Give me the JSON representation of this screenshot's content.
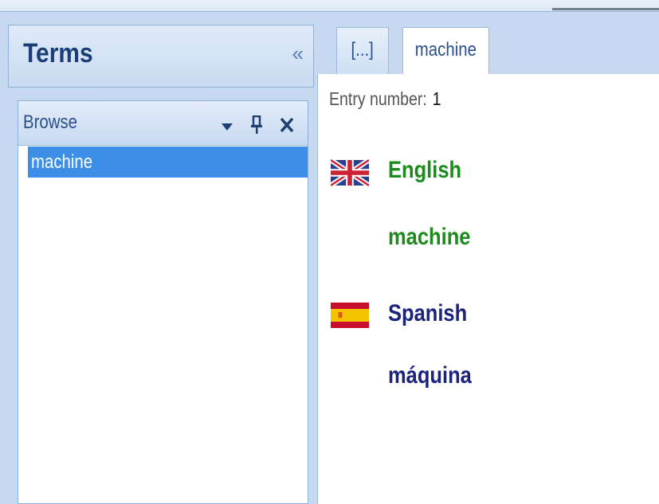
{
  "colors": {
    "english_green": "#1c8a1c",
    "spanish_navy": "#1b237a",
    "selection_blue": "#3d8ee6",
    "panel_blue": "#c6d9f1"
  },
  "terms_panel": {
    "title": "Terms",
    "collapse_icon": "double-chevron-left-icon",
    "collapse_glyph": "«"
  },
  "browse": {
    "label": "Browse",
    "dropdown_glyph": "▾",
    "pin_glyph": "⊥",
    "close_glyph": "✕",
    "items": [
      "machine"
    ]
  },
  "tabs": [
    {
      "label": "[...]"
    },
    {
      "label": "machine",
      "active": true
    }
  ],
  "entry": {
    "label": "Entry number:",
    "number": "1",
    "languages": [
      {
        "name": "English",
        "term": "machine",
        "flag": "uk-flag-icon"
      },
      {
        "name": "Spanish",
        "term": "máquina",
        "flag": "spain-flag-icon"
      }
    ]
  }
}
